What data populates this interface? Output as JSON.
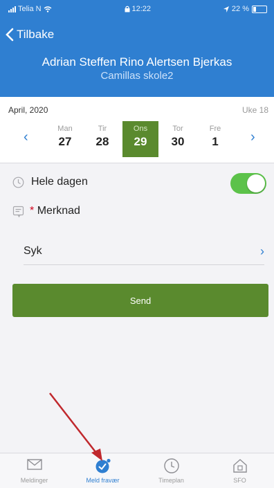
{
  "status_bar": {
    "carrier": "Telia N",
    "time": "12:22",
    "battery": "22 %"
  },
  "header": {
    "back_label": "Tilbake",
    "student_name": "Adrian Steffen Rino Alertsen Bjerkas",
    "school": "Camillas skole2"
  },
  "calendar": {
    "month": "April, 2020",
    "week": "Uke 18",
    "days": [
      {
        "name": "Man",
        "date": "27"
      },
      {
        "name": "Tir",
        "date": "28"
      },
      {
        "name": "Ons",
        "date": "29"
      },
      {
        "name": "Tor",
        "date": "30"
      },
      {
        "name": "Fre",
        "date": "1"
      }
    ],
    "selected_index": 2
  },
  "form": {
    "all_day_label": "Hele dagen",
    "all_day_on": true,
    "note_required_marker": "*",
    "note_label": "Merknad",
    "reason_value": "Syk",
    "send_label": "Send"
  },
  "tabbar": {
    "tabs": [
      {
        "label": "Meldinger",
        "icon": "envelope-icon"
      },
      {
        "label": "Meld fravær",
        "icon": "absence-icon"
      },
      {
        "label": "Timeplan",
        "icon": "clock-icon"
      },
      {
        "label": "SFO",
        "icon": "house-icon"
      }
    ],
    "active_index": 1
  },
  "colors": {
    "header_blue": "#2f7fd1",
    "accent_green": "#5a8a2e",
    "toggle_green": "#5cc24a",
    "annotation_arrow": "#c0282d"
  }
}
